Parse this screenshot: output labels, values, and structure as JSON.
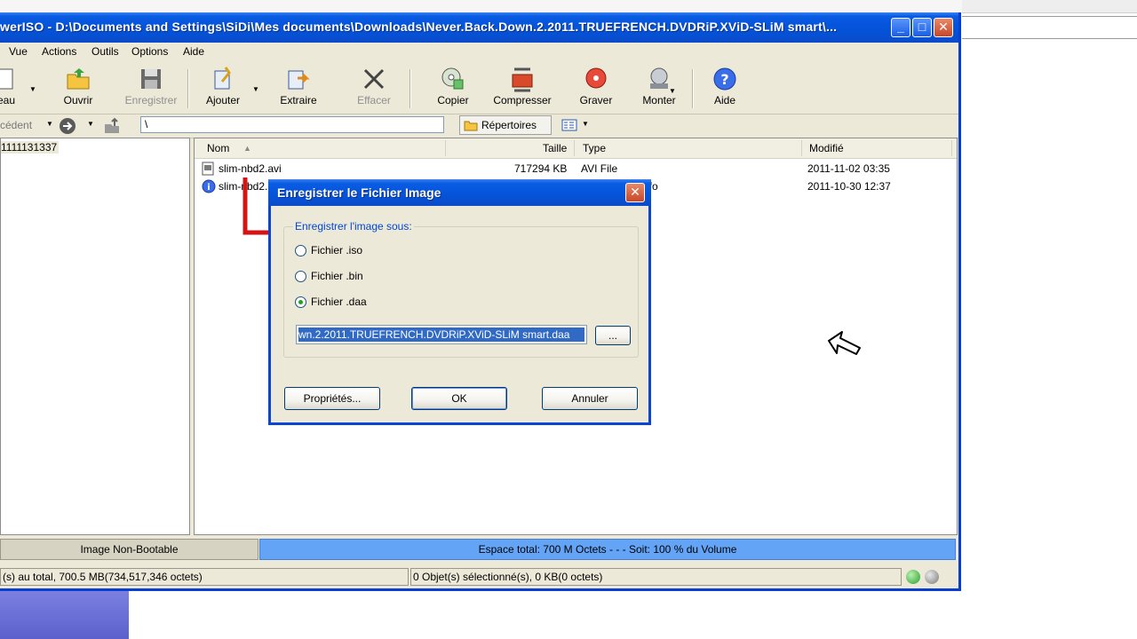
{
  "window": {
    "title": "werISO - D:\\Documents and Settings\\SiDi\\Mes documents\\Downloads\\Never.Back.Down.2.2011.TRUEFRENCH.DVDRiP.XViD-SLiM smart\\...",
    "minimize_glyph": "_",
    "maximize_glyph": "□",
    "close_glyph": "✕"
  },
  "menu": [
    "Vue",
    "Actions",
    "Outils",
    "Options",
    "Aide"
  ],
  "toolbar": {
    "nouveau_label": "eau",
    "ouvrir_label": "Ouvrir",
    "enregistrer_label": "Enregistrer",
    "ajouter_label": "Ajouter",
    "extraire_label": "Extraire",
    "effacer_label": "Effacer",
    "copier_label": "Copier",
    "compresser_label": "Compresser",
    "graver_label": "Graver",
    "monter_label": "Monter",
    "aide_label": "Aide"
  },
  "addressbar": {
    "back_label": "cédent",
    "path": "\\",
    "folders_label": "Répertoires"
  },
  "tree": {
    "root": "1111131337"
  },
  "list": {
    "columns": [
      "Nom",
      "Taille",
      "Type",
      "Modifié"
    ],
    "rows": [
      {
        "name": "slim-nbd2.avi",
        "size": "717294 KB",
        "type": "AVI File",
        "modified": "2011-11-02 03:35"
      },
      {
        "name": "slim-nbd2.",
        "size": "",
        "type": "nfo",
        "modified": "2011-10-30 12:37"
      }
    ]
  },
  "status": {
    "boot": "Image Non-Bootable",
    "space": "Espace total:  700 M Octets   - - -  Soit: 100 % du Volume",
    "total": "(s) au total, 700.5 MB(734,517,346 octets)",
    "selected": "0 Objet(s) sélectionné(s), 0 KB(0 octets)"
  },
  "dialog": {
    "title": "Enregistrer le Fichier Image",
    "close_glyph": "✕",
    "group_label": "Enregistrer l'image sous:",
    "options": [
      "Fichier .iso",
      "Fichier .bin",
      "Fichier .daa"
    ],
    "selected_option": "Fichier .daa",
    "path_value": "wn.2.2011.TRUEFRENCH.DVDRiP.XViD-SLiM smart.daa",
    "browse_label": "...",
    "properties_label": "Propriétés...",
    "ok_label": "OK",
    "cancel_label": "Annuler"
  },
  "colors": {
    "title_blue": "#0555dc",
    "space_bar": "#63a4f7",
    "selection": "#316ac5",
    "annotation_red": "#d41414"
  }
}
